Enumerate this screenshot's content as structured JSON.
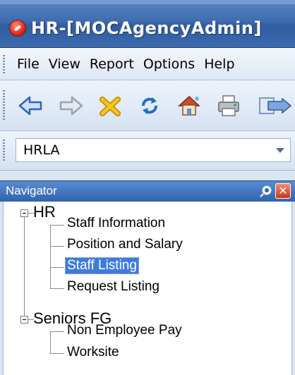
{
  "window": {
    "title": "HR-[MOCAgencyAdmin]"
  },
  "menu": {
    "items": [
      "File",
      "View",
      "Report",
      "Options",
      "Help"
    ]
  },
  "toolbar": {
    "buttons": [
      {
        "icon": "back-arrow-icon",
        "color": "#3a7bd5"
      },
      {
        "icon": "forward-arrow-icon",
        "color": "#9aa4b2"
      },
      {
        "icon": "delete-x-icon",
        "color": "#e0a800"
      },
      {
        "icon": "refresh-icon",
        "color": "#2c8ad6"
      },
      {
        "icon": "home-icon",
        "color": "#d04a2a"
      },
      {
        "icon": "print-icon",
        "color": "#8a8f99"
      },
      {
        "icon": "export-icon",
        "color": "#5a7fb8"
      }
    ]
  },
  "agency_selector": {
    "value": "HRLA"
  },
  "navigator": {
    "title": "Navigator",
    "tree": [
      {
        "label": "HR",
        "expanded": true,
        "children": [
          {
            "label": "Staff Information",
            "selected": false
          },
          {
            "label": "Position and Salary",
            "selected": false
          },
          {
            "label": "Staff Listing",
            "selected": true
          },
          {
            "label": "Request Listing",
            "selected": false
          }
        ]
      },
      {
        "label": "Seniors FG",
        "expanded": true,
        "children": [
          {
            "label": "Non Employee Pay",
            "selected": false
          },
          {
            "label": "Worksite",
            "selected": false
          }
        ]
      }
    ]
  },
  "colors": {
    "selection": "#3d7be0",
    "header": "#2f63ad",
    "close": "#d3341a"
  }
}
